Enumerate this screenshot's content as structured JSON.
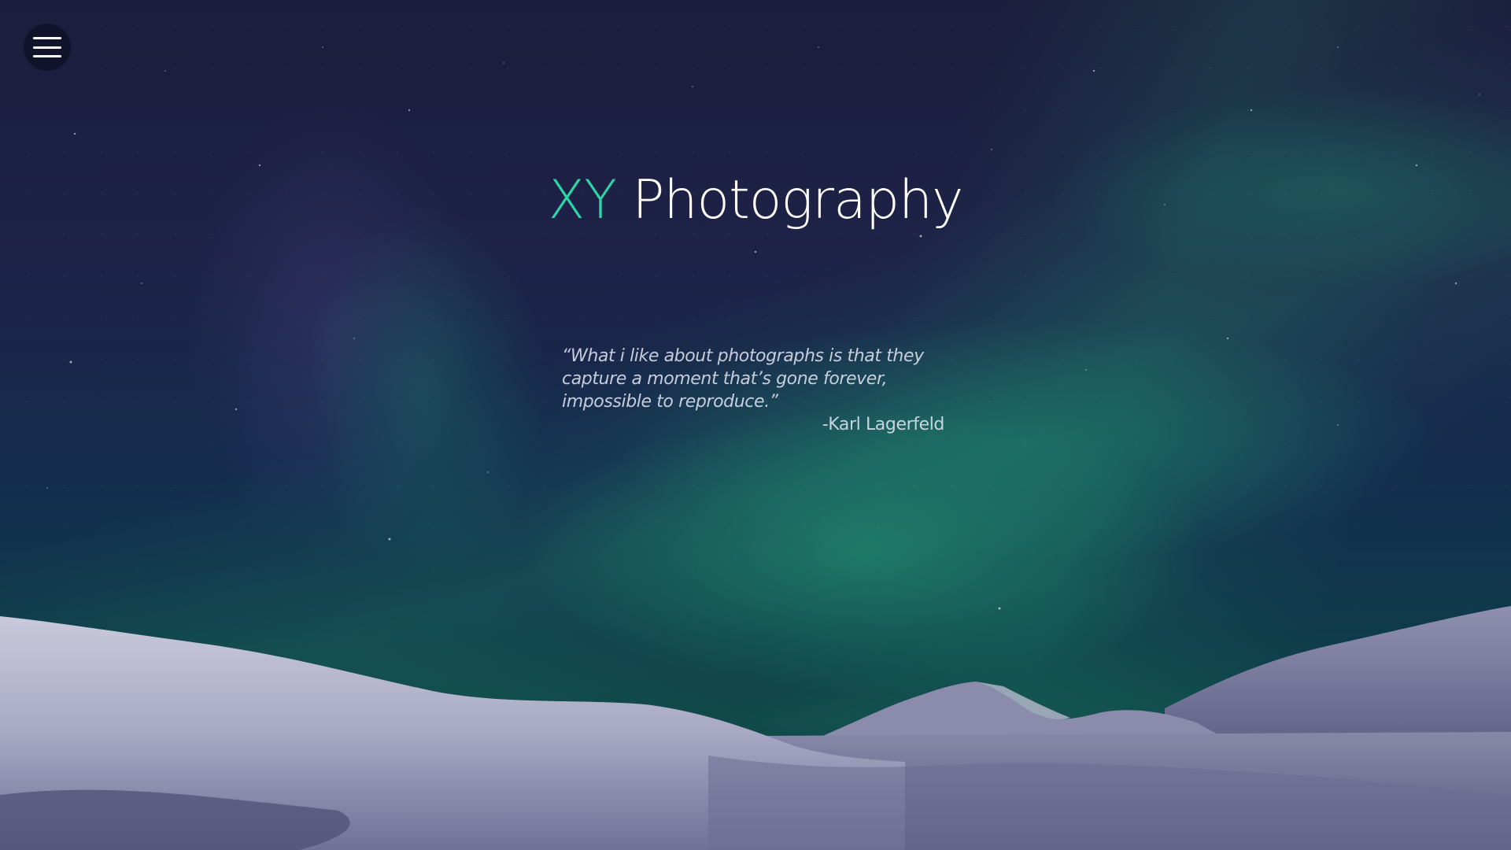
{
  "header": {
    "menu_icon": "hamburger-menu-icon"
  },
  "hero": {
    "title_brand": "XY",
    "title_rest": "Photography",
    "quote": "“What i like about photographs is that they capture a moment that’s gone forever, impossible to reproduce.”",
    "author": "-Karl Lagerfeld"
  },
  "colors": {
    "brand_accent": "#2ed3a8",
    "title_text": "#ffffff",
    "sky_top": "#1c1d3c",
    "aurora_green": "#26aa78"
  }
}
